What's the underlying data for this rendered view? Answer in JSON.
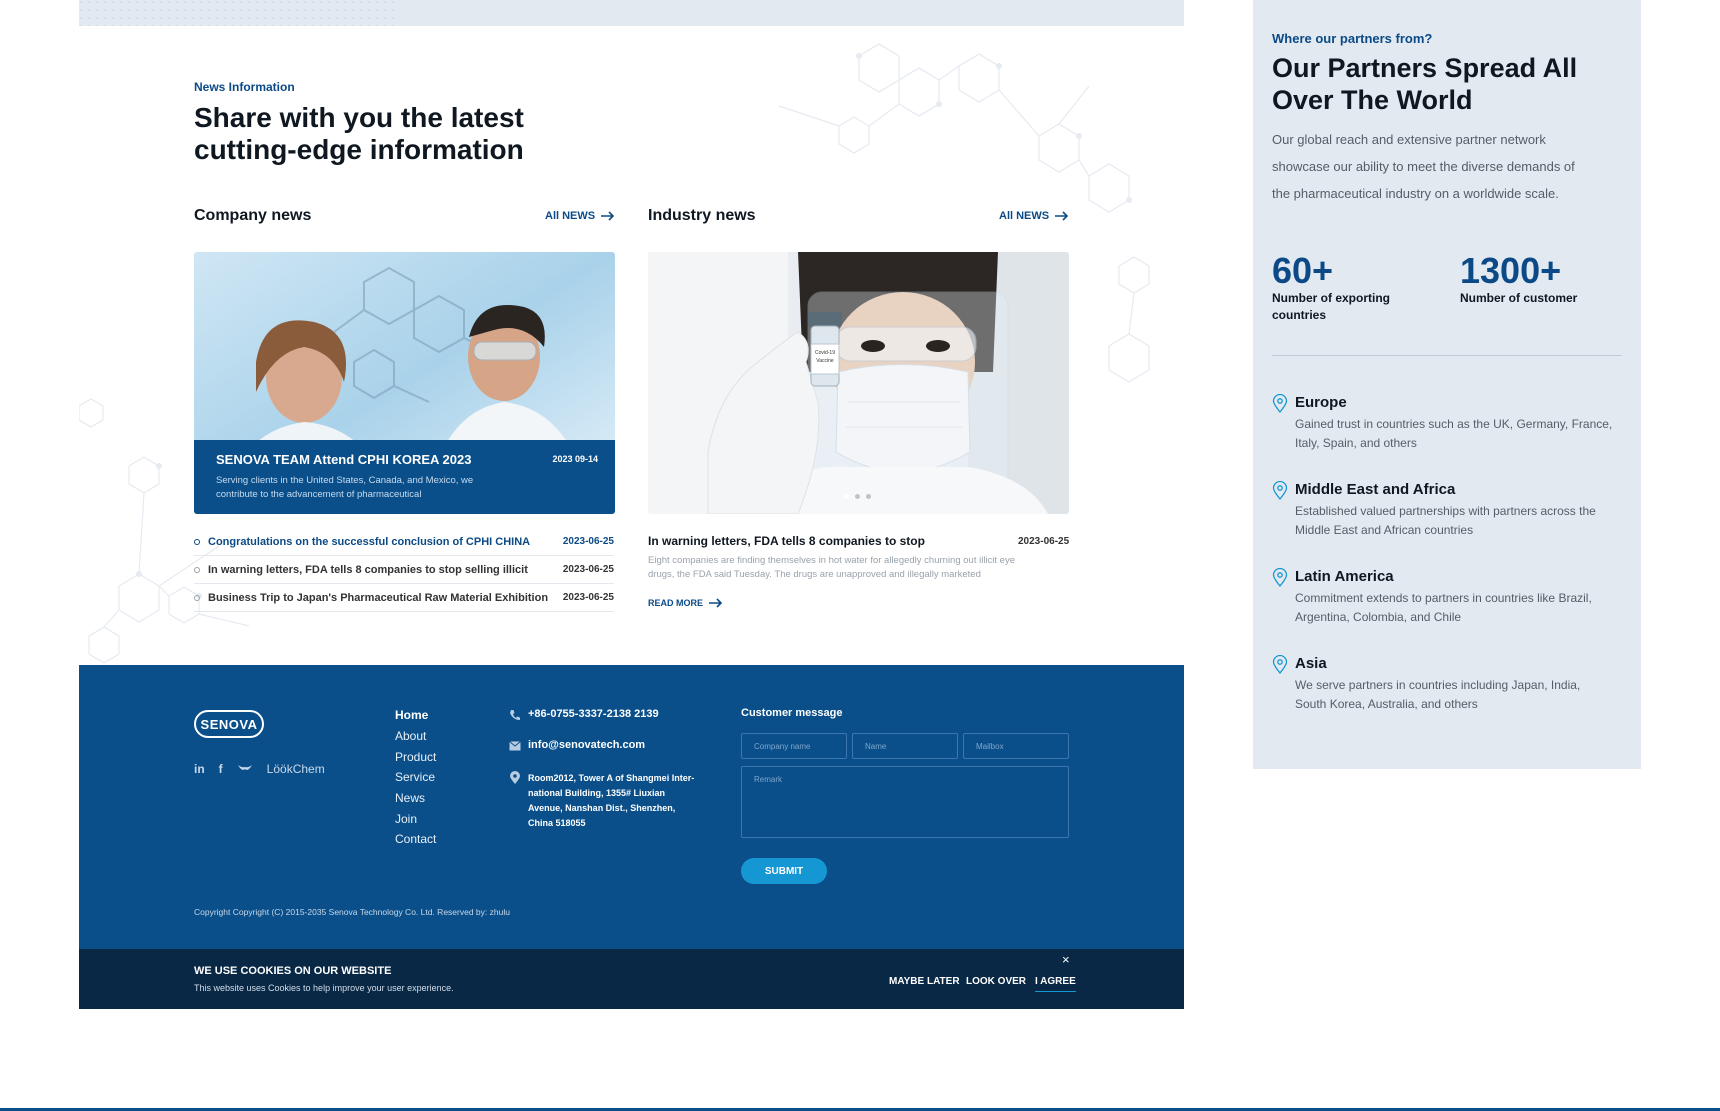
{
  "news": {
    "eyebrow": "News Information",
    "title_line1": "Share with you the latest",
    "title_line2": "cutting-edge information",
    "company": {
      "title": "Company news",
      "all_label": "All NEWS",
      "featured": {
        "headline": "SENOVA TEAM Attend CPHI KOREA 2023",
        "date": "2023 09-14",
        "desc_line1": "Serving clients in the United States, Canada, and Mexico, we",
        "desc_line2": "contribute to the advancement of pharmaceutical"
      },
      "list": [
        {
          "title": "Congratulations on the successful conclusion of CPHI CHINA",
          "date": "2023-06-25"
        },
        {
          "title": "In warning letters, FDA tells 8 companies to stop selling illicit",
          "date": "2023-06-25"
        },
        {
          "title": "Business Trip to Japan's Pharmaceutical Raw Material Exhibition",
          "date": "2023-06-25"
        }
      ]
    },
    "industry": {
      "title": "Industry news",
      "all_label": "All NEWS",
      "vial_label_line1": "Covid-19",
      "vial_label_line2": "Vaccine",
      "headline": "In warning letters, FDA tells 8 companies to stop",
      "date": "2023-06-25",
      "desc_line1": "Eight companies are finding themselves in hot water for allegedly churning out illicit eye",
      "desc_line2": "drugs, the FDA said Tuesday. The drugs are unapproved and illegally marketed",
      "read_more": "READ MORE"
    }
  },
  "footer": {
    "logo_text": "SENOVA",
    "social": [
      "in",
      "f",
      "LöökChem"
    ],
    "nav": [
      "Home",
      "About",
      "Product",
      "Service",
      "News",
      "Join",
      "Contact"
    ],
    "phone": "+86-0755-3337-2138 2139",
    "email": "info@senovatech.com",
    "address_lines": [
      "Room2012, Tower A of Shangmei Inter-",
      "national Building, 1355# Liuxian",
      "Avenue, Nanshan Dist., Shenzhen,",
      "China 518055"
    ],
    "form": {
      "title": "Customer message",
      "company_placeholder": "Company name",
      "name_placeholder": "Name",
      "mailbox_placeholder": "Mailbox",
      "remark_placeholder": "Remark",
      "submit": "SUBMIT"
    },
    "copyright": "Copyright Copyright (C) 2015-2035 Senova Technology Co. Ltd. Reserved by: zhulu"
  },
  "cookie": {
    "title": "WE USE COOKIES ON OUR WEBSITE",
    "desc": "This website uses Cookies to help improve your user experience.",
    "maybe_later": "MAYBE LATER",
    "look_over": "LOOK OVER",
    "agree": "I AGREE",
    "close": "×"
  },
  "partners": {
    "eyebrow": "Where our partners from?",
    "title_line1": "Our Partners Spread All",
    "title_line2": "Over The World",
    "desc_lines": [
      "Our global reach and extensive partner network",
      "showcase our ability to meet the diverse demands of",
      "the pharmaceutical industry on a worldwide scale."
    ],
    "stats": [
      {
        "value": "60+",
        "label_line1": "Number of exporting",
        "label_line2": "countries"
      },
      {
        "value": "1300+",
        "label_line1": "Number of customer",
        "label_line2": ""
      }
    ],
    "regions": [
      {
        "name": "Europe",
        "line1": "Gained trust in countries such as the UK, Germany, France,",
        "line2": "Italy, Spain, and others"
      },
      {
        "name": "Middle East and Africa",
        "line1": "Established valued partnerships with partners across the",
        "line2": "Middle East and African countries"
      },
      {
        "name": "Latin America",
        "line1": "Commitment extends to partners in countries like Brazil,",
        "line2": "Argentina, Colombia, and Chile"
      },
      {
        "name": "Asia",
        "line1": "We serve partners in countries including Japan, India,",
        "line2": "South Korea, Australia, and others"
      }
    ]
  },
  "colors": {
    "brand_blue": "#0a4f8a",
    "accent_cyan": "#1597d3",
    "panel_bg": "#e3e9f0",
    "cookie_bg": "#082846"
  }
}
